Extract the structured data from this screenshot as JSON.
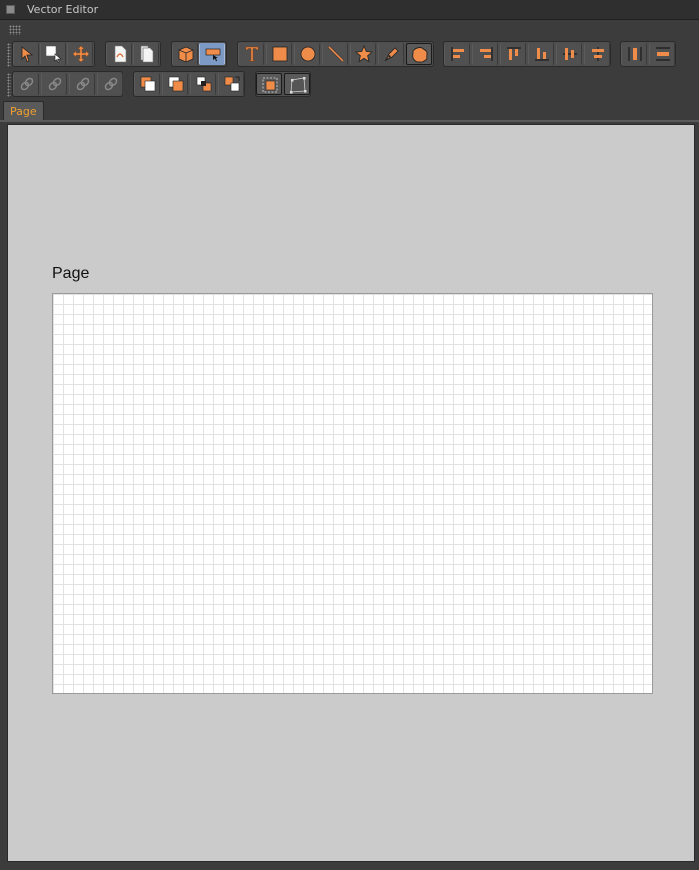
{
  "window": {
    "title": "Vector Editor"
  },
  "toolbar": {
    "row1": [
      {
        "group": "selection",
        "buttons": [
          "select-arrow-icon",
          "select-points-icon",
          "move-icon"
        ]
      },
      {
        "group": "export",
        "buttons": [
          "export-pdf-icon",
          "export-document-icon"
        ]
      },
      {
        "group": "view",
        "buttons": [
          "extrude-box-icon",
          "paint-bucket-icon"
        ],
        "active": "paint-bucket-icon"
      },
      {
        "group": "draw",
        "buttons": [
          "text-tool-icon",
          "rectangle-tool-icon",
          "ellipse-tool-icon",
          "line-tool-icon",
          "star-tool-icon",
          "pen-tool-icon",
          "blob-shape-icon"
        ],
        "selected": "blob-shape-icon"
      },
      {
        "group": "align",
        "buttons": [
          "align-left-icon",
          "align-right-icon",
          "align-top-icon",
          "align-bottom-icon",
          "align-center-vertical-icon",
          "align-center-horizontal-icon"
        ]
      },
      {
        "group": "distribute",
        "buttons": [
          "distribute-horizontal-icon",
          "distribute-vertical-icon"
        ]
      }
    ],
    "row2": [
      {
        "group": "link",
        "buttons": [
          "link-icon",
          "unlink-icon",
          "link-break-icon",
          "link-relink-icon"
        ]
      },
      {
        "group": "boolean",
        "buttons": [
          "bring-front-icon",
          "send-back-icon",
          "bring-forward-icon",
          "send-backward-icon"
        ]
      },
      {
        "group": "frame",
        "buttons": [
          "frame-select-icon",
          "transform-frame-icon"
        ]
      }
    ]
  },
  "tabs": [
    {
      "label": "Page",
      "active": true
    }
  ],
  "canvas": {
    "page_label": "Page",
    "background": "#cbcbcb",
    "sheet_color": "#ffffff",
    "grid_color": "#e2e2e2"
  },
  "colors": {
    "accent": "#f0a030",
    "icon_orange": "#f08c4a",
    "active_button": "#7d9ac4"
  }
}
